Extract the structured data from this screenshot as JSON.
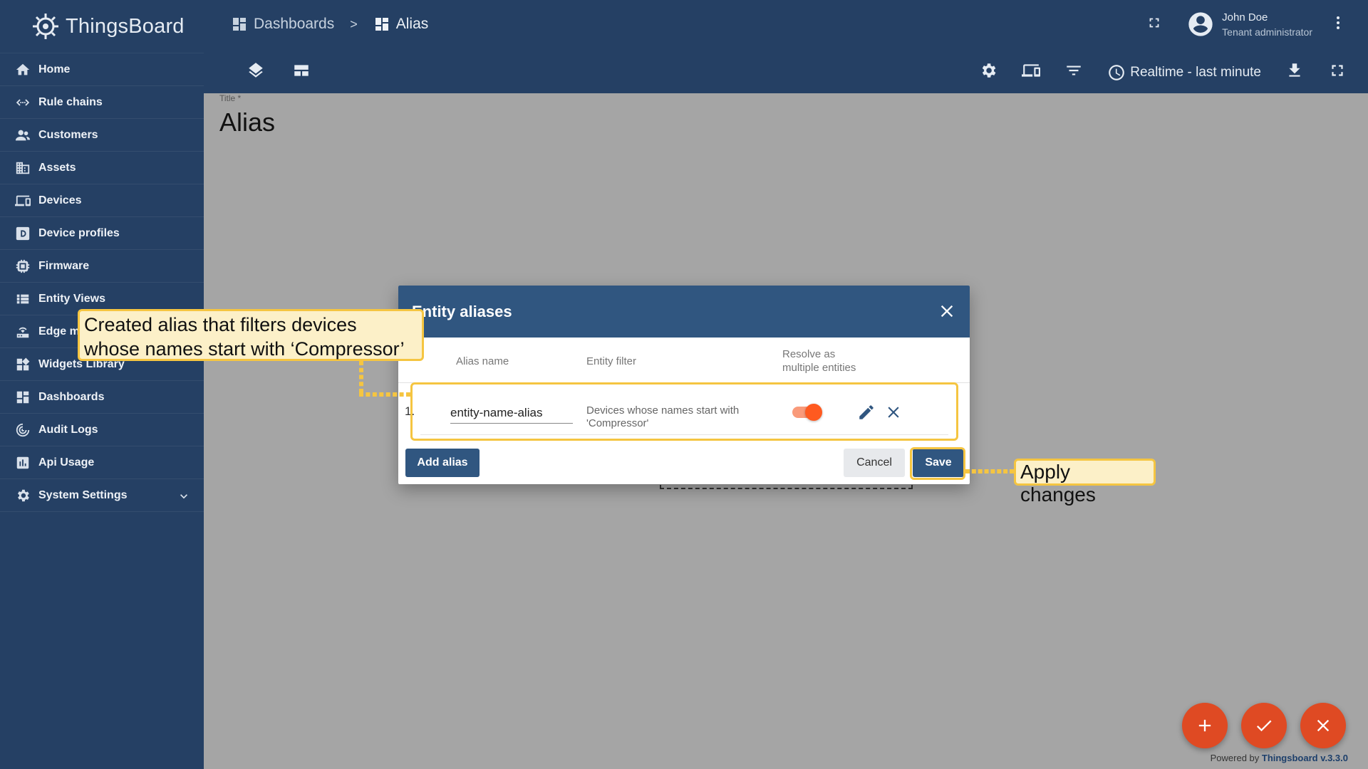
{
  "app": {
    "name": "ThingsBoard"
  },
  "sidebar": {
    "items": [
      {
        "label": "Home",
        "icon": "home-icon"
      },
      {
        "label": "Rule chains",
        "icon": "rule-chains-icon"
      },
      {
        "label": "Customers",
        "icon": "customers-icon"
      },
      {
        "label": "Assets",
        "icon": "assets-icon"
      },
      {
        "label": "Devices",
        "icon": "devices-icon"
      },
      {
        "label": "Device profiles",
        "icon": "device-profiles-icon"
      },
      {
        "label": "Firmware",
        "icon": "firmware-icon"
      },
      {
        "label": "Entity Views",
        "icon": "entity-views-icon"
      },
      {
        "label": "Edge m",
        "icon": "edge-icon"
      },
      {
        "label": "Widgets Library",
        "icon": "widgets-icon"
      },
      {
        "label": "Dashboards",
        "icon": "dashboards-icon"
      },
      {
        "label": "Audit Logs",
        "icon": "audit-logs-icon"
      },
      {
        "label": "Api Usage",
        "icon": "api-usage-icon"
      },
      {
        "label": "System Settings",
        "icon": "settings-icon"
      }
    ]
  },
  "header": {
    "breadcrumb": [
      "Dashboards",
      ">",
      "Alias"
    ],
    "user": {
      "name": "John Doe",
      "role": "Tenant administrator"
    },
    "timewindow": "Realtime - last minute"
  },
  "dashboard": {
    "title_label": "Title *",
    "title": "Alias"
  },
  "dialog": {
    "title": "Entity aliases",
    "columns": {
      "alias_name": "Alias name",
      "entity_filter": "Entity filter",
      "resolve_line1": "Resolve as",
      "resolve_line2": "multiple entities"
    },
    "rows": [
      {
        "index": "1.",
        "alias_name": "entity-name-alias",
        "filter_line1": "Devices whose names start with",
        "filter_line2": "'Compressor'",
        "resolve_multiple": true
      }
    ],
    "add_alias_label": "Add alias",
    "cancel_label": "Cancel",
    "save_label": "Save"
  },
  "annotations": {
    "row_note_line1": "Created alias that filters devices",
    "row_note_line2": "whose names start with  ‘Compressor’",
    "save_note": "Apply changes"
  },
  "footer": {
    "powered_prefix": "Powered by ",
    "powered_brand": "Thingsboard v.3.3.0"
  },
  "colors": {
    "sidebar": "#254064",
    "dialog_header": "#305680",
    "accent": "#df4a23",
    "highlight": "#f5c541"
  }
}
